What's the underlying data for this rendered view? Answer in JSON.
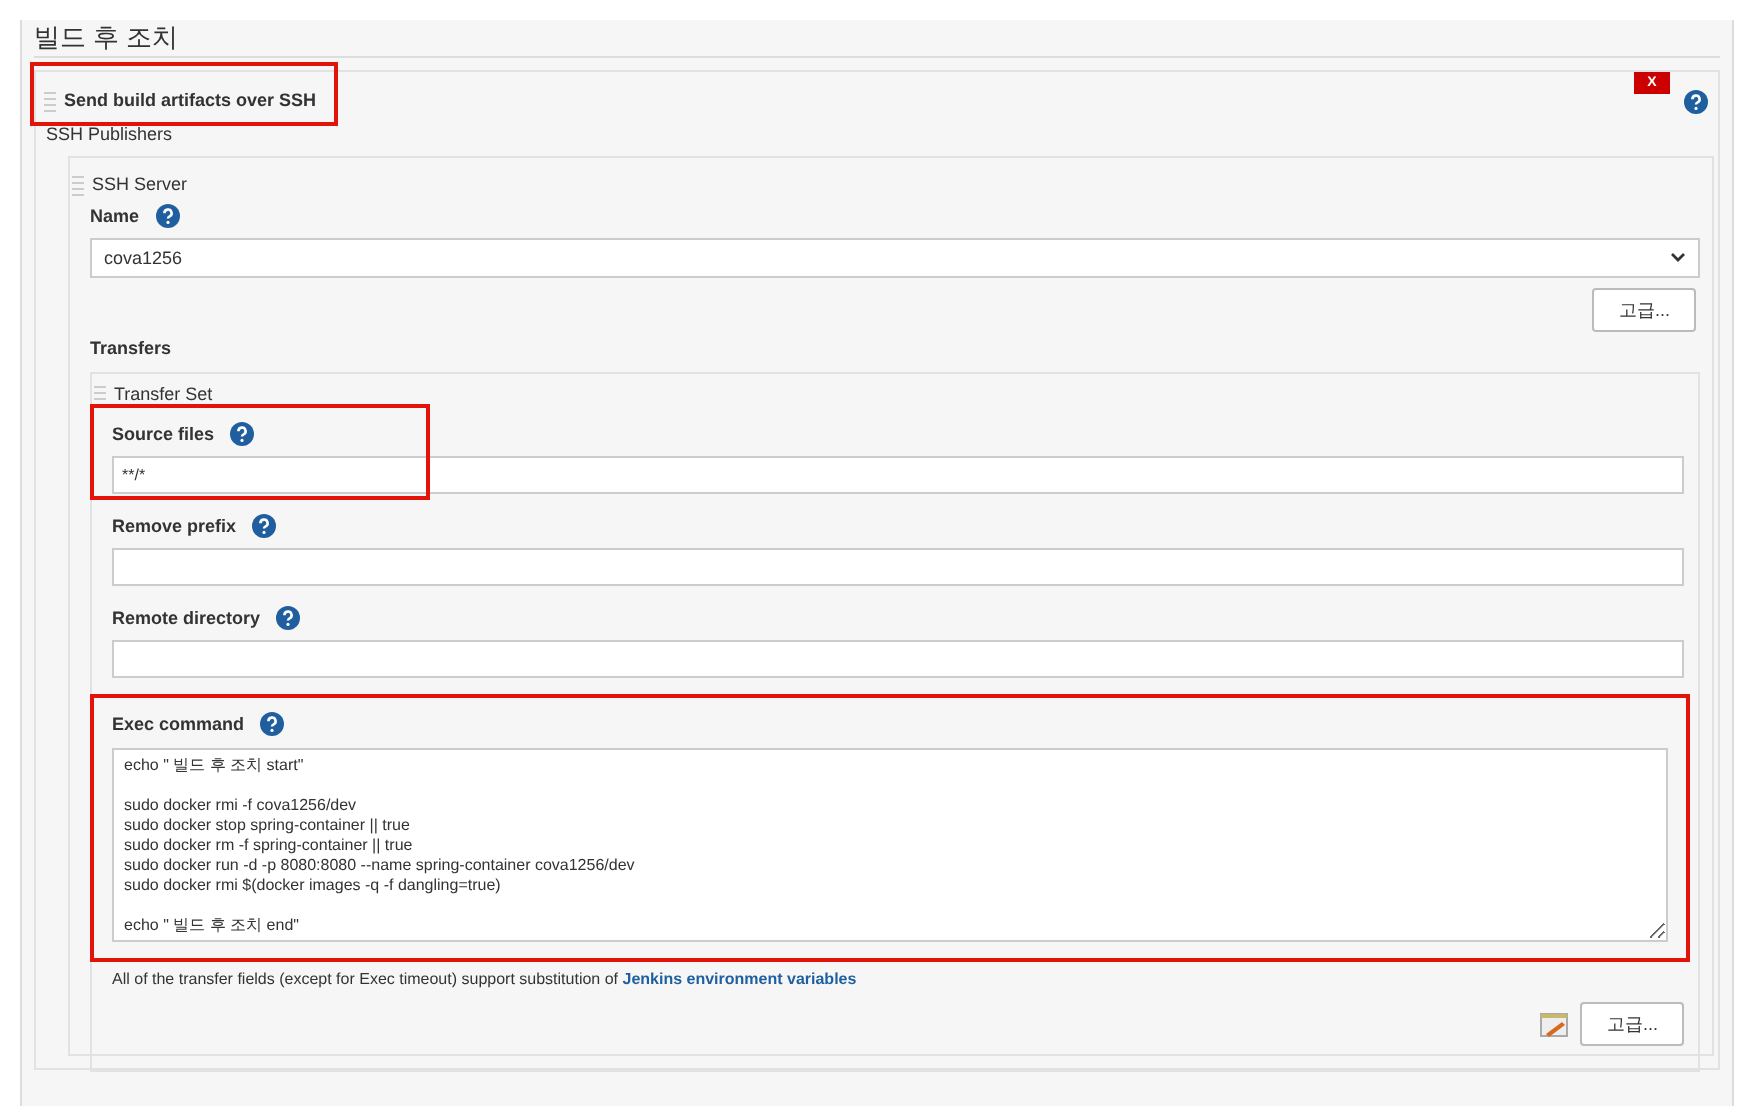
{
  "section_title": "빌드 후 조치",
  "step": {
    "title": "Send build artifacts over SSH",
    "delete_label": "X"
  },
  "publishers_label": "SSH Publishers",
  "server": {
    "label": "SSH Server",
    "name_label": "Name",
    "name_value": "cova1256",
    "advanced_button": "고급..."
  },
  "transfers_label": "Transfers",
  "transfer_set": {
    "label": "Transfer Set",
    "fields": [
      {
        "label": "Source files",
        "value": "**/*",
        "highlighted": true
      },
      {
        "label": "Remove prefix",
        "highlighted": false
      },
      {
        "label": "Remote directory",
        "highlighted": false
      }
    ],
    "exec": {
      "label": "Exec command",
      "highlighted": true,
      "blocks": [
        [
          "echo \" 빌드 후 조치 start\""
        ],
        [
          "sudo docker rmi -f cova1256/dev",
          "sudo docker stop spring-container || true",
          "sudo docker rm -f spring-container || true",
          "sudo docker run -d -p 8080:8080 --name spring-container cova1256/dev",
          "sudo docker rmi $(docker images -q -f dangling=true)"
        ],
        [
          "echo \" 빌드 후 조치 end\""
        ]
      ]
    },
    "note": {
      "text": "All of the transfer fields (except for Exec timeout) support substitution of",
      "link": "Jenkins environment variables"
    },
    "advanced_button": "고급..."
  }
}
